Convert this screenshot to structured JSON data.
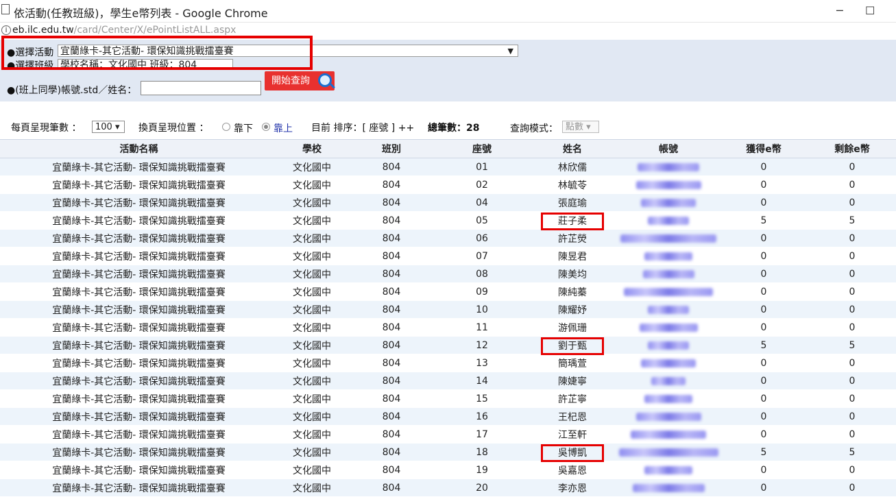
{
  "window": {
    "title": "依活動(任教班級)，學生e幣列表 - Google Chrome",
    "minimize": "─",
    "maximize": "☐"
  },
  "address": {
    "host": "eb.ilc.edu.tw",
    "path": "/card/Center/X/ePointListALL.aspx"
  },
  "filters": {
    "activity_label": "●選擇活動",
    "activity_value": "宜蘭綠卡-其它活動- 環保知識挑戰擂臺賽",
    "class_label": "●選擇班級",
    "class_value": "學校名稱：文化國中 班級：804",
    "account_label": "●(班上同學)帳號.std／姓名：",
    "account_value": "",
    "query_button": "開始查詢"
  },
  "options": {
    "per_page_label": "每頁呈現筆數 ：",
    "per_page_value": "100",
    "paging_pos_label": "換頁呈現位置 ：",
    "bottom_label": "靠下",
    "top_label": "靠上",
    "sort_label": "目前 排序：[ 座號 ] ++",
    "total_label": "總筆數：28",
    "mode_label": "查詢模式：",
    "mode_value": "點數"
  },
  "table": {
    "columns": [
      "活動名稱",
      "學校",
      "班別",
      "座號",
      "姓名",
      "帳號",
      "獲得e幣",
      "剩餘e幣"
    ],
    "rows": [
      {
        "activity": "宜蘭綠卡-其它活動- 環保知識挑戰擂臺賽",
        "school": "文化國中",
        "class": "804",
        "seat": "01",
        "name": "林欣儒",
        "earned": "0",
        "remain": "0"
      },
      {
        "activity": "宜蘭綠卡-其它活動- 環保知識挑戰擂臺賽",
        "school": "文化國中",
        "class": "804",
        "seat": "02",
        "name": "林毓苓",
        "earned": "0",
        "remain": "0"
      },
      {
        "activity": "宜蘭綠卡-其它活動- 環保知識挑戰擂臺賽",
        "school": "文化國中",
        "class": "804",
        "seat": "04",
        "name": "張庭瑜",
        "earned": "0",
        "remain": "0"
      },
      {
        "activity": "宜蘭綠卡-其它活動- 環保知識挑戰擂臺賽",
        "school": "文化國中",
        "class": "804",
        "seat": "05",
        "name": "莊子柔",
        "earned": "5",
        "remain": "5",
        "highlight": true
      },
      {
        "activity": "宜蘭綠卡-其它活動- 環保知識挑戰擂臺賽",
        "school": "文化國中",
        "class": "804",
        "seat": "06",
        "name": "許芷熒",
        "earned": "0",
        "remain": "0"
      },
      {
        "activity": "宜蘭綠卡-其它活動- 環保知識挑戰擂臺賽",
        "school": "文化國中",
        "class": "804",
        "seat": "07",
        "name": "陳昱君",
        "earned": "0",
        "remain": "0"
      },
      {
        "activity": "宜蘭綠卡-其它活動- 環保知識挑戰擂臺賽",
        "school": "文化國中",
        "class": "804",
        "seat": "08",
        "name": "陳美均",
        "earned": "0",
        "remain": "0"
      },
      {
        "activity": "宜蘭綠卡-其它活動- 環保知識挑戰擂臺賽",
        "school": "文化國中",
        "class": "804",
        "seat": "09",
        "name": "陳純蓁",
        "earned": "0",
        "remain": "0"
      },
      {
        "activity": "宜蘭綠卡-其它活動- 環保知識挑戰擂臺賽",
        "school": "文化國中",
        "class": "804",
        "seat": "10",
        "name": "陳耀妤",
        "earned": "0",
        "remain": "0"
      },
      {
        "activity": "宜蘭綠卡-其它活動- 環保知識挑戰擂臺賽",
        "school": "文化國中",
        "class": "804",
        "seat": "11",
        "name": "游佩珊",
        "earned": "0",
        "remain": "0"
      },
      {
        "activity": "宜蘭綠卡-其它活動- 環保知識挑戰擂臺賽",
        "school": "文化國中",
        "class": "804",
        "seat": "12",
        "name": "劉于甄",
        "earned": "5",
        "remain": "5",
        "highlight": true
      },
      {
        "activity": "宜蘭綠卡-其它活動- 環保知識挑戰擂臺賽",
        "school": "文化國中",
        "class": "804",
        "seat": "13",
        "name": "簡瑀萱",
        "earned": "0",
        "remain": "0"
      },
      {
        "activity": "宜蘭綠卡-其它活動- 環保知識挑戰擂臺賽",
        "school": "文化國中",
        "class": "804",
        "seat": "14",
        "name": "陳婕寧",
        "earned": "0",
        "remain": "0"
      },
      {
        "activity": "宜蘭綠卡-其它活動- 環保知識挑戰擂臺賽",
        "school": "文化國中",
        "class": "804",
        "seat": "15",
        "name": "許芷寧",
        "earned": "0",
        "remain": "0"
      },
      {
        "activity": "宜蘭綠卡-其它活動- 環保知識挑戰擂臺賽",
        "school": "文化國中",
        "class": "804",
        "seat": "16",
        "name": "王杞恩",
        "earned": "0",
        "remain": "0"
      },
      {
        "activity": "宜蘭綠卡-其它活動- 環保知識挑戰擂臺賽",
        "school": "文化國中",
        "class": "804",
        "seat": "17",
        "name": "江至軒",
        "earned": "0",
        "remain": "0"
      },
      {
        "activity": "宜蘭綠卡-其它活動- 環保知識挑戰擂臺賽",
        "school": "文化國中",
        "class": "804",
        "seat": "18",
        "name": "吳博凱",
        "earned": "5",
        "remain": "5",
        "highlight": true
      },
      {
        "activity": "宜蘭綠卡-其它活動- 環保知識挑戰擂臺賽",
        "school": "文化國中",
        "class": "804",
        "seat": "19",
        "name": "吳嘉恩",
        "earned": "0",
        "remain": "0"
      },
      {
        "activity": "宜蘭綠卡-其它活動- 環保知識挑戰擂臺賽",
        "school": "文化國中",
        "class": "804",
        "seat": "20",
        "name": "李亦恩",
        "earned": "0",
        "remain": "0"
      }
    ]
  },
  "colors": {
    "accent_red": "#e60000",
    "query_button": "#e8312f",
    "panel_bg": "#e1e8f3",
    "row_alt": "#edf4fb"
  }
}
